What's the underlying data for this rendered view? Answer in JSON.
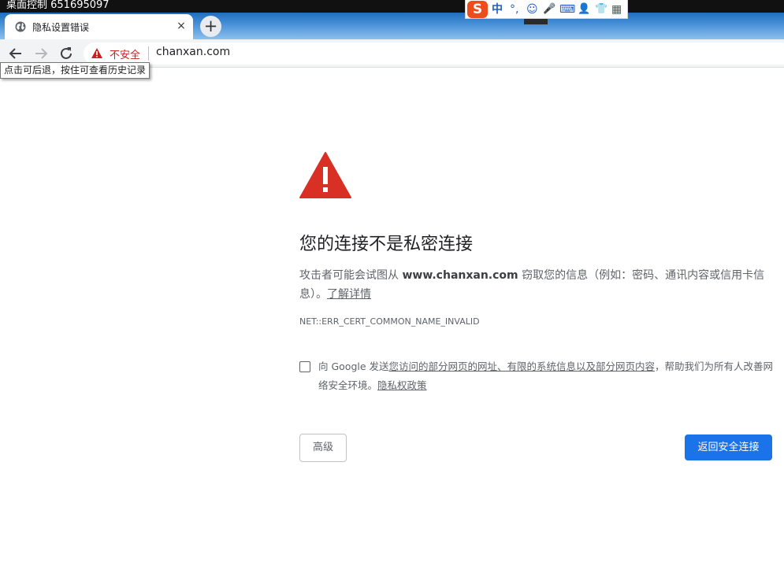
{
  "remote": {
    "title": "桌面控制 651695097"
  },
  "browser": {
    "tab": {
      "title": "隐私设置错误",
      "close": "×"
    },
    "new_tab": "+",
    "address": {
      "security_label": "不安全",
      "url": "chanxan.com"
    },
    "tooltip": "点击可后退，按住可查看历史记录"
  },
  "ime": {
    "logo": "S",
    "mode": "中",
    "punct": "°,",
    "emoji": "☺",
    "mic": "🎤",
    "keyboard": "⌨",
    "user": "👤",
    "skin": "👕",
    "grid": "▦"
  },
  "error_page": {
    "heading": "您的连接不是私密连接",
    "body_before": "攻击者可能会试图从 ",
    "body_domain": "www.chanxan.com",
    "body_after": " 窃取您的信息（例如：密码、通讯内容或信用卡信息）。",
    "learn_more": "了解详情",
    "error_code": "NET::ERR_CERT_COMMON_NAME_INVALID",
    "optin_prefix": "向 Google 发送",
    "optin_link": "您访问的部分网页的网址、有限的系统信息以及部分网页内容",
    "optin_suffix": "，帮助我们为所有人改善网络安全环境。",
    "optin_policy": "隐私权政策",
    "advanced_button": "高级",
    "back_button": "返回安全连接"
  },
  "colors": {
    "warning_red": "#d93025",
    "primary_blue": "#1a73e8",
    "not_secure_red": "#c5221f"
  }
}
